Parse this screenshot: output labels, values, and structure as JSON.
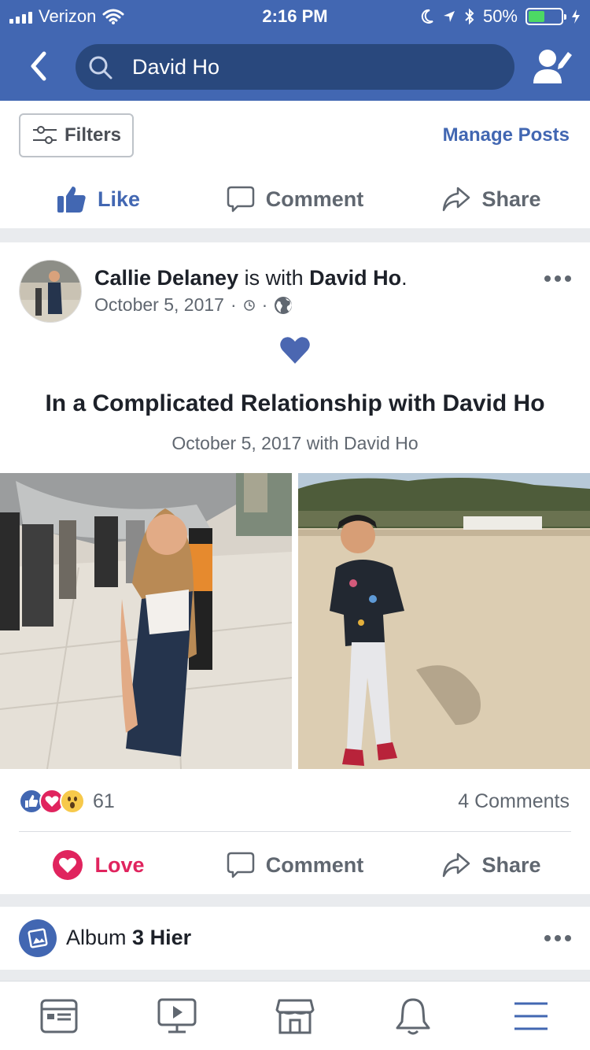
{
  "status_bar": {
    "carrier": "Verizon",
    "time": "2:16 PM",
    "battery_percent": "50%",
    "battery_level": 0.5
  },
  "header": {
    "search_value": "David Ho",
    "accent": "#4267b2"
  },
  "filters": {
    "filters_label": "Filters",
    "manage_label": "Manage Posts"
  },
  "top_actions": {
    "like_label": "Like",
    "comment_label": "Comment",
    "share_label": "Share"
  },
  "post": {
    "author": "Callie Delaney",
    "is_with": "is with",
    "tagged": "David Ho",
    "period": ".",
    "date": "October 5, 2017",
    "dot": "·",
    "life_event_title": "In a Complicated Relationship with David Ho",
    "life_event_sub": "October 5, 2017 with David Ho",
    "reaction_count": "61",
    "comments_count": "4 Comments",
    "love_label": "Love",
    "comment_label": "Comment",
    "share_label": "Share"
  },
  "album": {
    "prefix": "Album",
    "name": "3 Hier"
  },
  "tabbar": {
    "icons": [
      "news-feed-icon",
      "watch-icon",
      "marketplace-icon",
      "notifications-icon",
      "menu-icon"
    ]
  }
}
